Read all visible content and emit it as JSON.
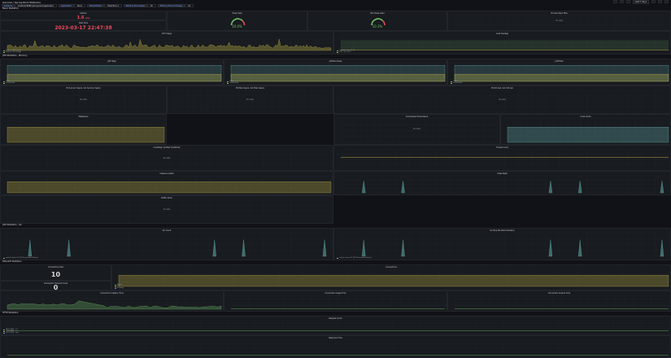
{
  "topbar": {
    "title": "General / Spring Boot Statistics",
    "time_range": "Last 7 days"
  },
  "variables": [
    {
      "label": "Instance",
      "value": "localhost:8080 spring-boot-application"
    },
    {
      "label": "Application",
      "value": "None"
    },
    {
      "label": "HikariCP-Pool",
      "value": "HikariPool-1"
    },
    {
      "label": "Memory Pool (heap)",
      "value": "All"
    },
    {
      "label": "Memory Pool (nonheap)",
      "value": "All"
    }
  ],
  "rows": [
    "Basic Statistics",
    "JVM Statistics - Memory",
    "JVM Statistics - GC",
    "HikariCP Statistics",
    "HTTP Statistics"
  ],
  "no_data": "No data",
  "panels": {
    "uptime": {
      "title": "Uptime",
      "value": "1.6",
      "unit": "mo"
    },
    "start_time": {
      "title": "Start time",
      "value": "2023-03-17 22:47:38"
    },
    "heap_used": {
      "title": "Heap Used",
      "value": "10.0%"
    },
    "nonheap_used": {
      "title": "Non-Heap Used",
      "value": "10.3%"
    },
    "open_files": {
      "title": "Process Open Files"
    },
    "cpu": {
      "title": "CPU Usage",
      "legend": [
        "System CPU Usage",
        "Process CPU Usage"
      ]
    },
    "load": {
      "title": "Load Average",
      "legend": [
        "Load Average [1m]",
        "CPU Core Size"
      ]
    },
    "jvm_heap": {
      "title": "JVM Heap",
      "legend": [
        "Used",
        "Committed"
      ]
    },
    "jvm_nonheap": {
      "title": "JVM Non-Heap",
      "legend": [
        "Used",
        "Committed"
      ]
    },
    "jvm_total": {
      "title": "JVM Total",
      "legend": [
        "Used",
        "Committed"
      ]
    },
    "survivor": {
      "title": "PS Survivor Space / G1 Survivor Space"
    },
    "eden": {
      "title": "PS Eden Space / G1 Eden Space"
    },
    "oldgen": {
      "title": "PS Old Gen / G1 Old Gen"
    },
    "metaspace": {
      "title": "Metaspace"
    },
    "compressed": {
      "title": "Compressed Class Space"
    },
    "codecache": {
      "title": "Code Cache"
    },
    "codeheap": {
      "title": "CodeHeap 'profiled nmethods'"
    },
    "threads": {
      "title": "Thread Count"
    },
    "classes": {
      "title": "Classes Loaded"
    },
    "gc_count": {
      "title": "Class Delta"
    },
    "buffer": {
      "title": "Buffer Pools"
    },
    "mem_alloc": {
      "title": "Memory Allocate/Promote"
    },
    "log": {
      "title": "Log Events"
    },
    "gc_pause": {
      "title": "GC Count",
      "legend": [
        "end of minor GC [G1 Evacuation Pause]"
      ]
    },
    "gc_stop": {
      "title": "GC Stop the World Duration",
      "legend": [
        "end of minor GC [G1 Evacuation Pause]"
      ]
    },
    "conn_size": {
      "title": "Connections Size",
      "value": "10"
    },
    "conn_timeout": {
      "title": "Connection Timeout Count",
      "value": "0"
    },
    "connections": {
      "title": "Connections",
      "legend": [
        "Active",
        "Idle",
        "Pending"
      ]
    },
    "conn_create": {
      "title": "Connection Creation Time"
    },
    "conn_usage": {
      "title": "Connection Usage Time"
    },
    "conn_acquire": {
      "title": "Connection Acquire Time"
    },
    "req_count": {
      "title": "Request Count",
      "legend": [
        "GET [200] - /**",
        "GET [404] - /**",
        "GET [200] - /api"
      ]
    },
    "resp_time": {
      "title": "Response Time"
    }
  },
  "colors": {
    "yellow": "#c8b648",
    "green": "#73bf69",
    "blue": "#5794f2",
    "red": "#f2495c",
    "teal": "#6ab7b7"
  }
}
